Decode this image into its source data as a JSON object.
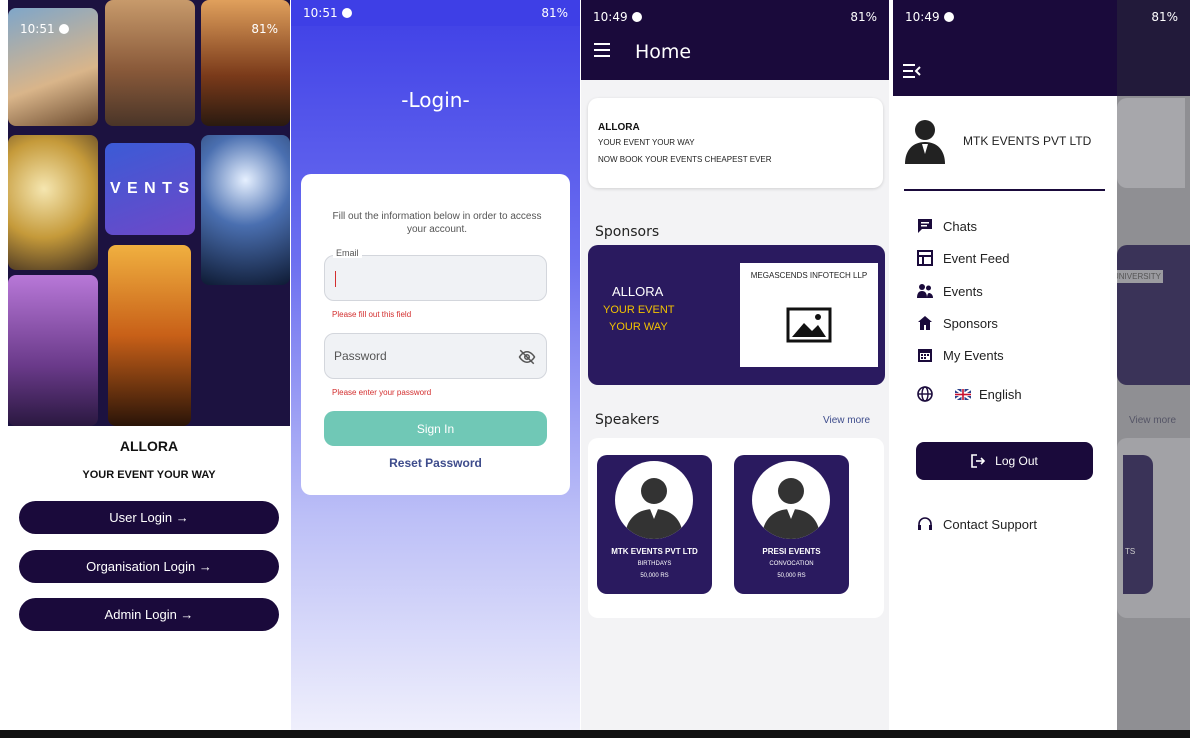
{
  "screen1": {
    "status": {
      "time": "10:51",
      "battery": "81%"
    },
    "brand": "ALLORA",
    "tagline": "YOUR EVENT YOUR WAY",
    "tile_texts": {
      "vents": "V E N T S"
    },
    "buttons": {
      "user_login": "User Login →",
      "org_login": "Organisation Login →",
      "admin_login": "Admin Login →"
    }
  },
  "screen2": {
    "status": {
      "time": "10:51",
      "battery": "81%"
    },
    "title": "-Login-",
    "hint": "Fill out the information below in order to access your account.",
    "email_label": "Email",
    "email_error": "Please fill out this field",
    "password_placeholder": "Password",
    "password_error": "Please enter your password",
    "signin": "Sign In",
    "reset": "Reset Password"
  },
  "screen3": {
    "status": {
      "time": "10:49",
      "battery": "81%"
    },
    "header_title": "Home",
    "intro": {
      "name": "ALLORA",
      "line1": "YOUR EVENT YOUR WAY",
      "line2": "NOW BOOK YOUR EVENTS CHEAPEST EVER"
    },
    "sponsors_title": "Sponsors",
    "sponsor": {
      "brand": "ALLORA",
      "tag1": "YOUR EVENT",
      "tag2": "YOUR WAY",
      "partner": "MEGASCENDS INFOTECH LLP"
    },
    "speakers_title": "Speakers",
    "view_more": "View more",
    "speakers": [
      {
        "name": "MTK EVENTS PVT LTD",
        "category": "BIRTHDAYS",
        "price": "50,000 RS"
      },
      {
        "name": "PRESI EVENTS",
        "category": "CONVOCATION",
        "price": "50,000 RS"
      }
    ]
  },
  "screen4": {
    "status": {
      "time": "10:49",
      "battery": "81%"
    },
    "profile_name": "MTK EVENTS PVT LTD",
    "menu": [
      "Chats",
      "Event Feed",
      "Events",
      "Sponsors",
      "My Events"
    ],
    "language": "English",
    "logout": "Log Out",
    "contact": "Contact Support",
    "behind": {
      "university": "UNIVERSITY",
      "view_more": "View more",
      "partial": "TS"
    }
  },
  "colors": {
    "primary": "#1a0a3b",
    "card": "#2a1a5f",
    "accent_yellow": "#f2c200",
    "signin": "#70c8b6",
    "error": "#d32f2f",
    "login_gradient": "#3e3fe6"
  },
  "icons": [
    "hamburger-icon",
    "eye-off-icon",
    "image-placeholder-icon",
    "person-icon",
    "chat-icon",
    "event-feed-icon",
    "group-icon",
    "sponsors-icon",
    "calendar-icon",
    "globe-icon",
    "flag-icon",
    "logout-icon",
    "support-icon",
    "drawer-close-icon"
  ]
}
